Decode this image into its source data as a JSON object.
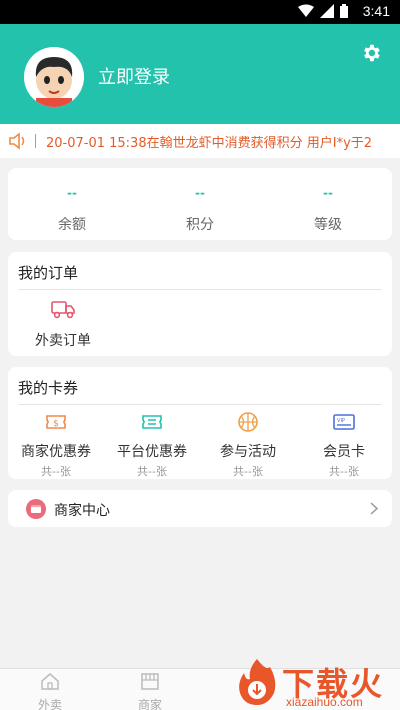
{
  "status_bar": {
    "time": "3:41",
    "wifi_icon": "wifi-icon",
    "signal_icon": "signal-icon",
    "battery_icon": "battery-icon"
  },
  "header": {
    "login_text": "立即登录",
    "avatar_icon": "avatar-icon",
    "settings_icon": "gear-icon",
    "bg_color": "#23c2ad"
  },
  "ticker": {
    "message": "20-07-01 15:38在翰世龙虾中消费获得积分   用户I*y于2",
    "icon": "speaker-icon",
    "color": "#e25c2a"
  },
  "stats": [
    {
      "value": "--",
      "label": "余额"
    },
    {
      "value": "--",
      "label": "积分"
    },
    {
      "value": "--",
      "label": "等级"
    }
  ],
  "orders": {
    "title": "我的订单",
    "items": [
      {
        "label": "外卖订单",
        "icon": "delivery-truck-icon"
      }
    ]
  },
  "coupons": {
    "title": "我的卡券",
    "items": [
      {
        "label": "商家优惠券",
        "sub": "共--张",
        "icon": "merchant-coupon-icon"
      },
      {
        "label": "平台优惠券",
        "sub": "共--张",
        "icon": "platform-coupon-icon"
      },
      {
        "label": "参与活动",
        "sub": "共--张",
        "icon": "basketball-icon"
      },
      {
        "label": "会员卡",
        "sub": "共--张",
        "icon": "vip-card-icon"
      }
    ]
  },
  "merchant": {
    "label": "商家中心",
    "icon": "merchant-center-icon",
    "chevron": "chevron-right-icon"
  },
  "tabbar": {
    "tabs": [
      {
        "label": "外卖",
        "icon": "home-icon"
      },
      {
        "label": "商家",
        "icon": "store-icon"
      }
    ]
  },
  "watermark": {
    "brand": "下载火",
    "url": "xiazaihuo.com"
  }
}
